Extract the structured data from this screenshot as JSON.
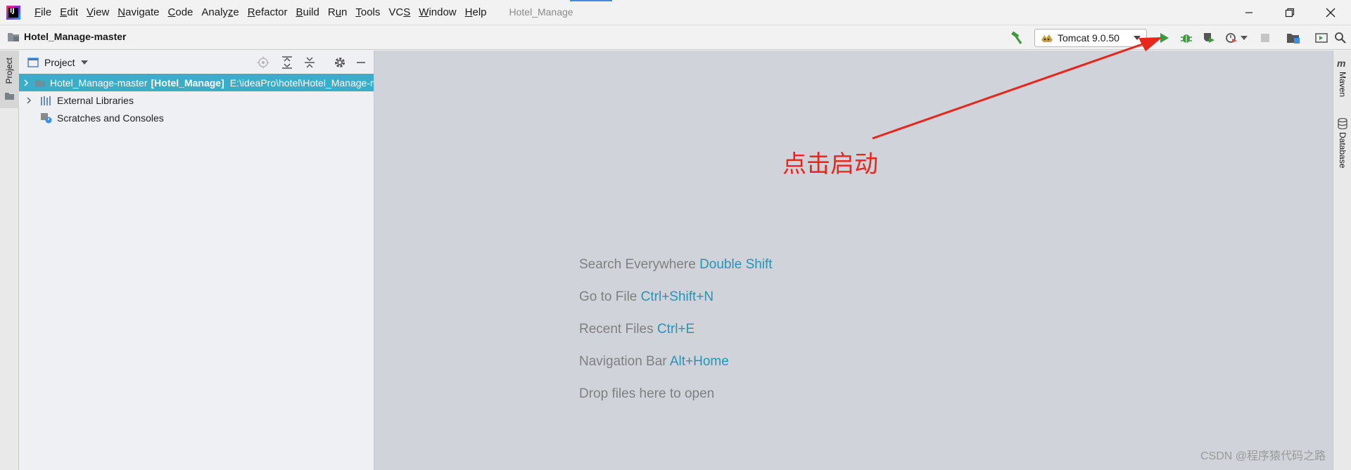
{
  "menu": {
    "items": [
      {
        "pre": "",
        "u": "F",
        "post": "ile"
      },
      {
        "pre": "",
        "u": "E",
        "post": "dit"
      },
      {
        "pre": "",
        "u": "V",
        "post": "iew"
      },
      {
        "pre": "",
        "u": "N",
        "post": "avigate"
      },
      {
        "pre": "",
        "u": "C",
        "post": "ode"
      },
      {
        "pre": "Analy",
        "u": "z",
        "post": "e"
      },
      {
        "pre": "",
        "u": "R",
        "post": "efactor"
      },
      {
        "pre": "",
        "u": "B",
        "post": "uild"
      },
      {
        "pre": "R",
        "u": "u",
        "post": "n"
      },
      {
        "pre": "",
        "u": "T",
        "post": "ools"
      },
      {
        "pre": "VC",
        "u": "S",
        "post": ""
      },
      {
        "pre": "",
        "u": "W",
        "post": "indow"
      },
      {
        "pre": "",
        "u": "H",
        "post": "elp"
      }
    ],
    "window_title": "Hotel_Manage"
  },
  "toolbar": {
    "breadcrumb": "Hotel_Manage-master",
    "run_config": "Tomcat 9.0.50"
  },
  "left_stripe": {
    "project_tab": "Project"
  },
  "project_panel": {
    "title": "Project",
    "tree": [
      {
        "name": "Hotel_Manage-master",
        "module": "[Hotel_Manage]",
        "path": "E:\\ideaPro\\hotel\\Hotel_Manage-master"
      },
      {
        "name": "External Libraries"
      },
      {
        "name": "Scratches and Consoles"
      }
    ]
  },
  "editor": {
    "hints": [
      {
        "text": "Search Everywhere",
        "key": "Double Shift"
      },
      {
        "text": "Go to File",
        "key": "Ctrl+Shift+N"
      },
      {
        "text": "Recent Files",
        "key": "Ctrl+E"
      },
      {
        "text": "Navigation Bar",
        "key": "Alt+Home"
      },
      {
        "text": "Drop files here to open",
        "key": ""
      }
    ],
    "annotation": "点击启动",
    "watermark": "CSDN @程序猿代码之路"
  },
  "right_stripe": {
    "maven": "Maven",
    "database": "Database"
  },
  "colors": {
    "selection": "#3aaec8",
    "editor_bg": "#d0d3da",
    "hint_key": "#2794b6",
    "annotation": "#e8261b",
    "run_green": "#3c9a3c"
  }
}
